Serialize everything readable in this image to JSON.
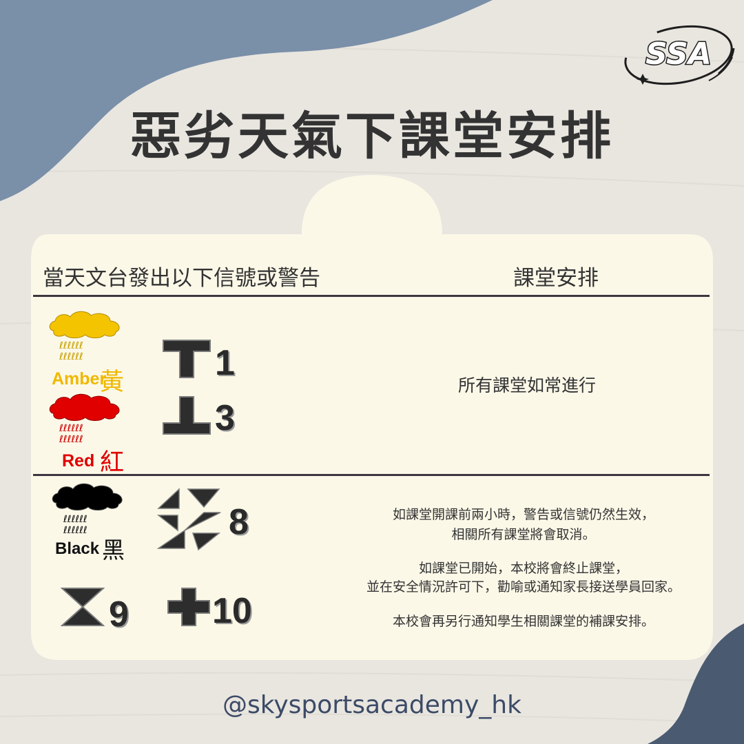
{
  "title": "惡劣天氣下課堂安排",
  "logo_text": "SSA",
  "table": {
    "header_left": "當天文台發出以下信號或警告",
    "header_right": "課堂安排"
  },
  "rows": [
    {
      "warnings": [
        {
          "en": "Amber",
          "zh": "黃",
          "color": "#f5c400"
        },
        {
          "en": "Red",
          "zh": "紅",
          "color": "#e00000"
        }
      ],
      "signals": [
        "1",
        "3"
      ],
      "arrangement": "所有課堂如常進行"
    },
    {
      "warnings": [
        {
          "en": "Black",
          "zh": "黑",
          "color": "#000000"
        }
      ],
      "signals": [
        "8",
        "9",
        "10"
      ],
      "arrangement_lines": [
        "如課堂開課前兩小時，警告或信號仍然生效，",
        "相關所有課堂將會取消。",
        "如課堂已開始，本校將會終止課堂，",
        "並在安全情況許可下，勸喻或通知家長接送學員回家。",
        "本校會再另行通知學生相關課堂的補課安排。"
      ]
    }
  ],
  "handle": "@skysportsacademy_hk",
  "colors": {
    "background": "#e9e6e0",
    "blob": "#7a8fa8",
    "blob_dark": "#4a5a70",
    "card": "#fbf8e8",
    "title": "#333333",
    "handle": "#3b4a66"
  },
  "icons": {
    "amber_warning": "amber-rainstorm-icon",
    "red_warning": "red-rainstorm-icon",
    "black_warning": "black-rainstorm-icon",
    "signal_1": "standby-signal-icon",
    "signal_3": "strong-wind-signal-icon",
    "signal_8": "gale-signal-icon",
    "signal_9": "increasing-gale-signal-icon",
    "signal_10": "hurricane-signal-icon"
  }
}
